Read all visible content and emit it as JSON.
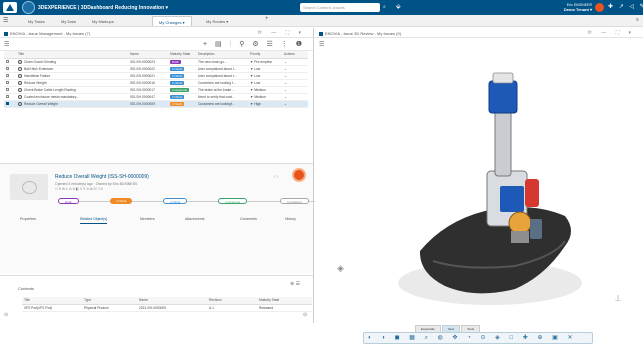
{
  "topbar": {
    "brand": "3DEXPERIENCE | 3DDashboard  Reducing Innovation ▾",
    "search_placeholder": "Search Content, Assets",
    "user_role": "Eric ENGINEER",
    "user_name": "Demo Tenant ▾",
    "right_icons": "✚ ↗ ◁ ✎"
  },
  "tabs": [
    {
      "label": "My Tasks",
      "active": false
    },
    {
      "label": "My Data",
      "active": false
    },
    {
      "label": "My Markups",
      "active": false
    },
    {
      "label": "My Changes ▾",
      "active": true
    },
    {
      "label": "My Routes ▾",
      "active": false
    }
  ],
  "left_panel": {
    "title": "ENOVIA - Issue Management - My Issues (7)",
    "columns": [
      "",
      "Title",
      "Name",
      "Maturity State",
      "Description",
      "Priority",
      "Actions"
    ],
    "rows": [
      {
        "title": "Chain Guard Grinding",
        "name": "ISS-SH-0000023",
        "state": "Draft",
        "state_color": "#8a3ab9",
        "desc": "The new chain gu...",
        "priority": "Pre-emptive",
        "sel": false
      },
      {
        "title": "Ball Hitch Extension",
        "name": "ISS-SH-0000022",
        "state": "In Work",
        "state_color": "#3d8fd1",
        "desc": "User complained about t...",
        "priority": "Low",
        "sel": false
      },
      {
        "title": "Handlebar Failure",
        "name": "ISS-SH-0000021",
        "state": "In Work",
        "state_color": "#3d8fd1",
        "desc": "User complained about t...",
        "priority": "Low",
        "sel": false
      },
      {
        "title": "Reduce Weight",
        "name": "ISS-SH-0000016",
        "state": "In Work",
        "state_color": "#3d8fd1",
        "desc": "Customers are looking f...",
        "priority": "Low",
        "sel": false
      },
      {
        "title": "Check Brake Cable Length Routing",
        "name": "ISS-SH-0000017",
        "state": "In Approval",
        "state_color": "#3aa36a",
        "desc": "The brake at the brake ...",
        "priority": "Medium",
        "sel": false
      },
      {
        "title": "Coated enclosure needs mandatory...",
        "name": "ISS-SH-0000047",
        "state": "In Work",
        "state_color": "#3d8fd1",
        "desc": "Need to verify that coat...",
        "priority": "Medium",
        "sel": false
      },
      {
        "title": "Reduce Overall Weight",
        "name": "ISS-SH-0000009",
        "state": "In Work",
        "state_color": "#f08a24",
        "desc": "Customers are lookingf...",
        "priority": "High",
        "sel": true
      }
    ]
  },
  "detail": {
    "title": "Reduce Overall Weight (ISS-SH-0000009)",
    "meta1": "Opened 3 minute(s) ago · Owned by Eric BUSINESS",
    "meta2": "☐ 0  ✉ 1  ⊙ 0  ◧ 1  ✎ 0  ⊘ 0  ☐ 0",
    "steps": [
      "Draft",
      "In Work",
      "In Work",
      "In Approval",
      "Completed"
    ],
    "tabs": [
      "Properties",
      "Related Object(s)",
      "Members",
      "Attachments",
      "Comments",
      "History"
    ],
    "nav": "‹  ›"
  },
  "contents": {
    "title": "Contents",
    "columns": [
      "Title",
      "Type",
      "Name",
      "Revision",
      "Maturity State"
    ],
    "row": [
      "VP2 Pod(VP2 Pod)",
      "Physical Product",
      "2021-SH-0000009",
      "A.1",
      "Released"
    ]
  },
  "right_panel": {
    "title": "ENOVIA - Issue 3D Review - My Issues (0)",
    "view_tabs": [
      "Essentials",
      "View",
      "Tools"
    ],
    "toolbar": "◐ ◑ ◼ ▦ ⌕ ◍ ✥ ◔ ⊙ ◈ □ ✚ ⊕ ▣ ✕"
  }
}
